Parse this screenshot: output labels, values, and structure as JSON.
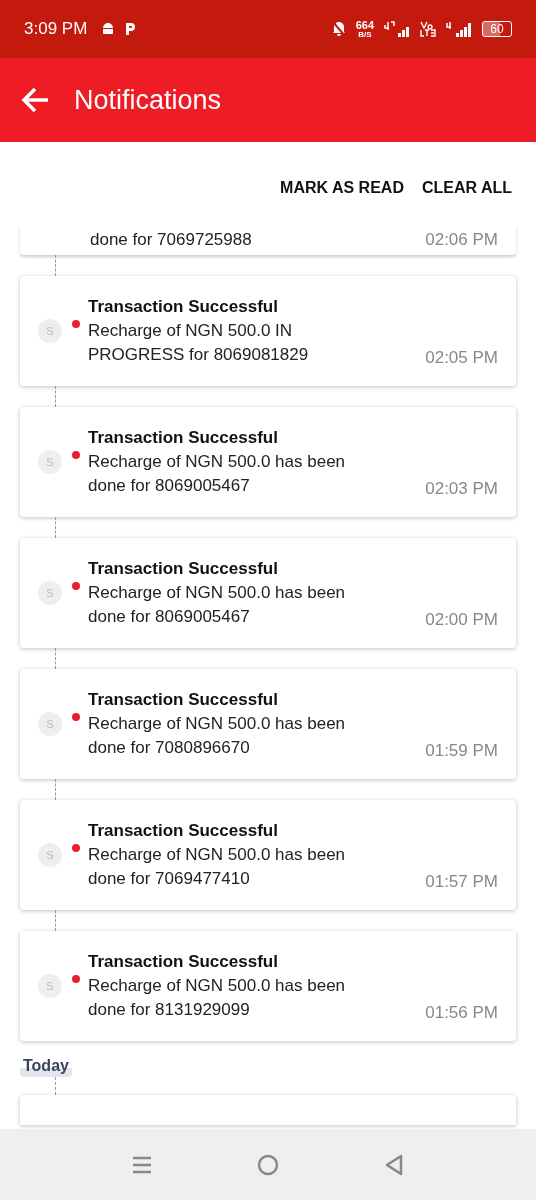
{
  "status_bar": {
    "time": "3:09 PM",
    "net_speed": "664",
    "net_unit": "B/S",
    "battery": "60"
  },
  "app_bar": {
    "title": "Notifications"
  },
  "actions": [
    "MARK AS READ",
    "CLEAR ALL"
  ],
  "partial_top": {
    "message": "done for 7069725988",
    "time": "02:06 PM"
  },
  "notifications": [
    {
      "avatar": "S",
      "unread": true,
      "title": "Transaction Successful",
      "message": "Recharge of NGN 500.0 IN PROGRESS for 8069081829",
      "time": "02:05 PM"
    },
    {
      "avatar": "S",
      "unread": true,
      "title": "Transaction Successful",
      "message": "Recharge of NGN 500.0 has been done for 8069005467",
      "time": "02:03 PM"
    },
    {
      "avatar": "S",
      "unread": true,
      "title": "Transaction Successful",
      "message": "Recharge of NGN 500.0 has been done for 8069005467",
      "time": "02:00 PM"
    },
    {
      "avatar": "S",
      "unread": true,
      "title": "Transaction Successful",
      "message": "Recharge of NGN 500.0 has been done for 7080896670",
      "time": "01:59 PM"
    },
    {
      "avatar": "S",
      "unread": true,
      "title": "Transaction Successful",
      "message": "Recharge of NGN 500.0 has been done for 7069477410",
      "time": "01:57 PM"
    },
    {
      "avatar": "S",
      "unread": true,
      "title": "Transaction Successful",
      "message": "Recharge of NGN 500.0 has been done for 8131929099",
      "time": "01:56 PM"
    }
  ],
  "section_label": "Today"
}
